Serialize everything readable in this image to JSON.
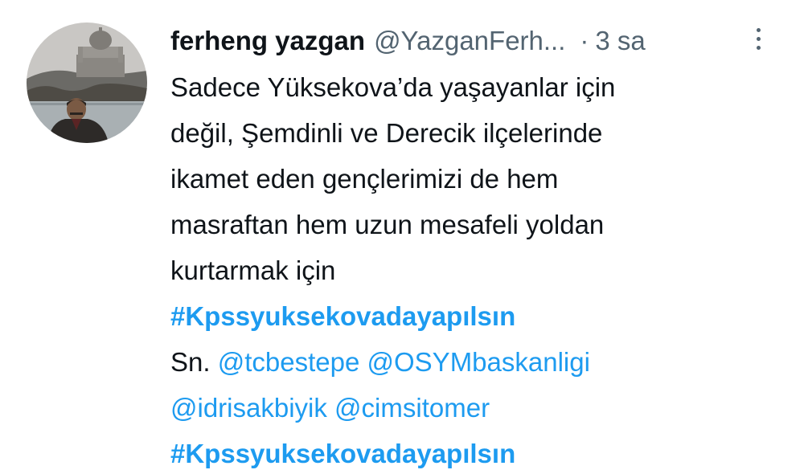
{
  "tweet": {
    "author": {
      "display_name": "ferheng yazgan",
      "handle": "@YazganFerh...",
      "avatar_icon": "user-avatar-photo"
    },
    "separator": "·",
    "timestamp": "3 sa",
    "more_icon": "more-options-vertical-icon",
    "text_lines": [
      "Sadece Yüksekova’da yaşayanlar için",
      "değil, Şemdinli ve Derecik ilçelerinde",
      "ikamet eden gençlerimizi de hem",
      "masraftan hem uzun mesafeli yoldan",
      "kurtarmak için"
    ],
    "hashtag_1": "#Kpssyuksekovadayapılsın",
    "prefix": "Sn.",
    "mentions": [
      "@tcbestepe",
      "@OSYMbaskanligi",
      "@idrisakbiyik",
      "@cimsitomer"
    ],
    "hashtag_2": "#Kpssyuksekovadayapılsın",
    "colors": {
      "link": "#1d9bf0",
      "text": "#0f1419",
      "muted": "#536471"
    }
  }
}
